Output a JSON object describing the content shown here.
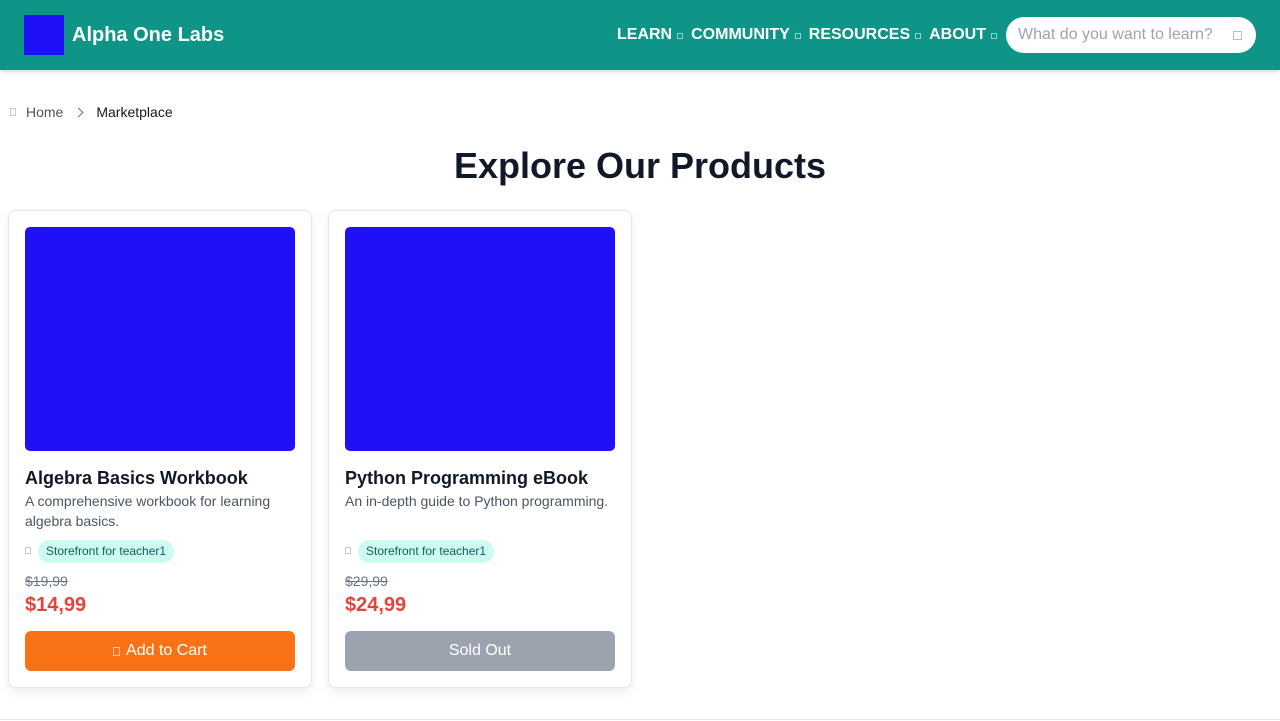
{
  "brand": {
    "name": "Alpha One Labs"
  },
  "nav": {
    "items": [
      {
        "label": "LEARN"
      },
      {
        "label": "COMMUNITY"
      },
      {
        "label": "RESOURCES"
      },
      {
        "label": "ABOUT"
      }
    ]
  },
  "search": {
    "placeholder": "What do you want to learn?",
    "value": ""
  },
  "breadcrumb": {
    "home": "Home",
    "current": "Marketplace"
  },
  "page": {
    "title": "Explore Our Products"
  },
  "products": [
    {
      "title": "Algebra Basics Workbook",
      "description": "A comprehensive workbook for learning algebra basics.",
      "storefront": "Storefront for teacher1",
      "old_price": "$19,99",
      "price": "$14,99",
      "button": "Add to Cart"
    },
    {
      "title": "Python Programming eBook",
      "description": "An in-depth guide to Python programming.",
      "storefront": "Storefront for teacher1",
      "old_price": "$29,99",
      "price": "$24,99",
      "button": "Sold Out"
    }
  ],
  "colors": {
    "header": "#0f9488",
    "logo": "#2010f5",
    "product_image": "#2010f5",
    "sale_price": "#e3443d",
    "add_to_cart": "#f97316",
    "sold_out": "#9ca3af",
    "badge_bg": "#ccfbf1"
  },
  "icons": {
    "nav_caret": "chevron-down-icon",
    "search": "search-icon",
    "home": "home-icon",
    "breadcrumb_separator": "chevron-right-icon",
    "store": "store-icon",
    "cart": "cart-icon"
  }
}
